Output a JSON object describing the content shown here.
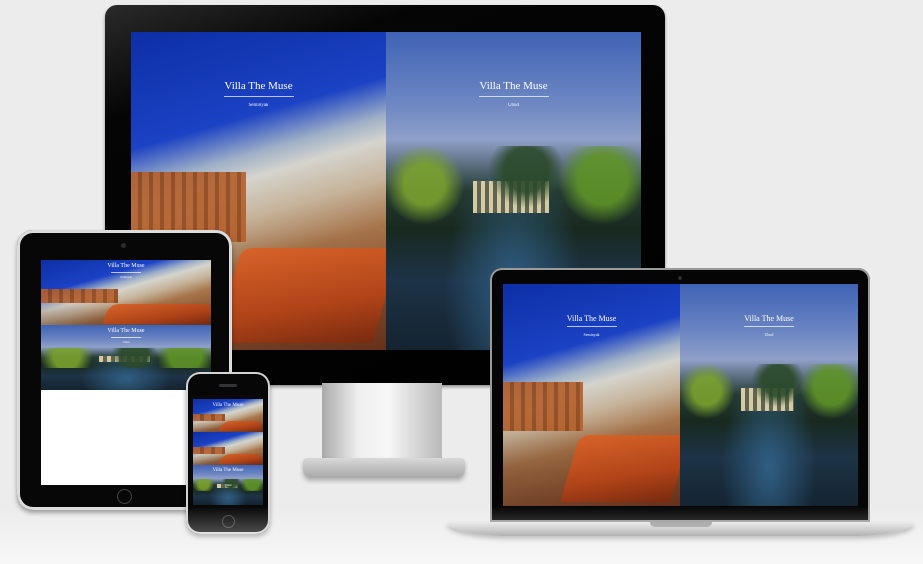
{
  "site": {
    "brand": "Villa The Muse",
    "left_tagline": "Seminyak",
    "right_tagline": "Ubud"
  },
  "devices": [
    "desktop-monitor",
    "laptop",
    "tablet",
    "phone"
  ],
  "colors": {
    "background": "#ececec",
    "bezel": "#000000",
    "sky_blue": "#1b42c4",
    "brand_text": "#ffffff"
  }
}
